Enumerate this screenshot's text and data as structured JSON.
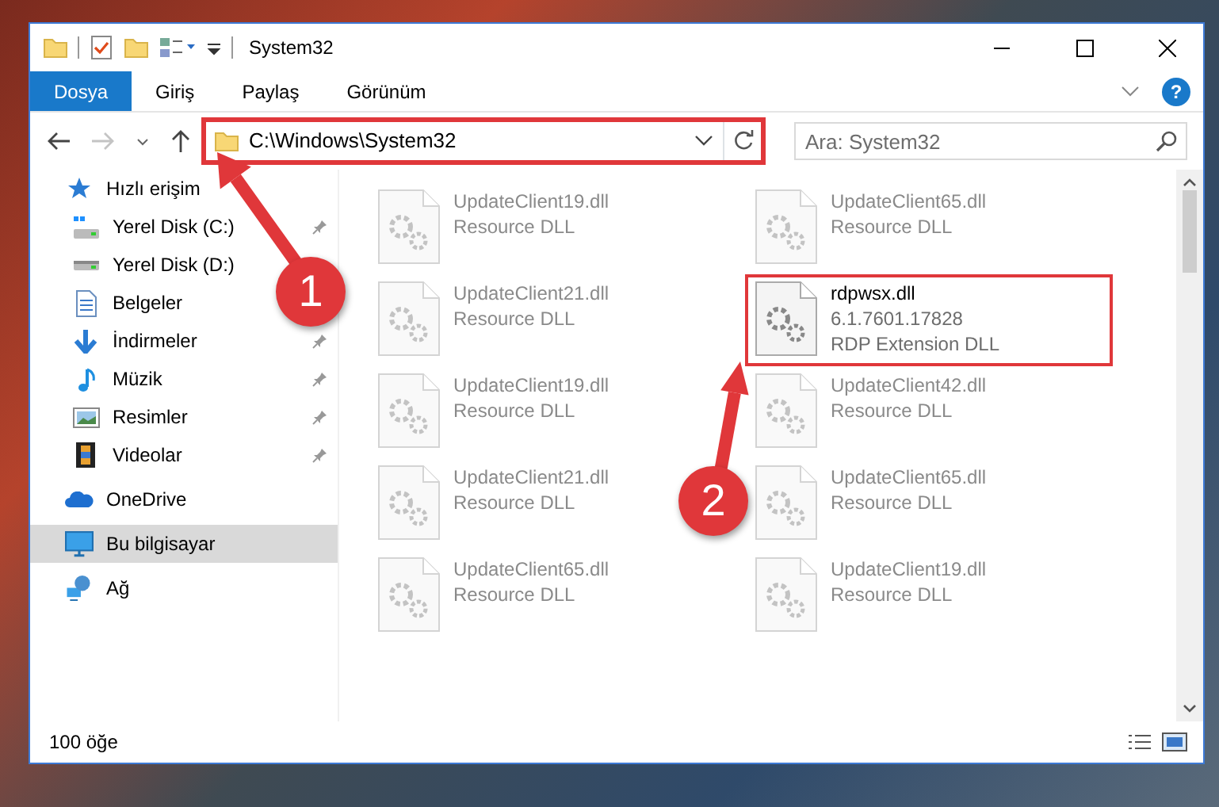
{
  "window": {
    "title": "System32"
  },
  "ribbon": {
    "tabs": [
      {
        "label": "Dosya",
        "kind": "file",
        "selected": false
      },
      {
        "label": "Giriş",
        "kind": "tab",
        "selected": false
      },
      {
        "label": "Paylaş",
        "kind": "tab",
        "selected": false
      },
      {
        "label": "Görünüm",
        "kind": "tab",
        "selected": false
      }
    ],
    "help": "?"
  },
  "navigation": {
    "back_disabled": false,
    "forward_disabled": true,
    "address": {
      "value": "C:\\Windows\\System32",
      "highlighted": true
    },
    "search": {
      "placeholder": "Ara: System32"
    }
  },
  "sidebar": {
    "items": [
      {
        "label": "Hızlı erişim",
        "pinned": false,
        "selected": false,
        "children": [
          {
            "label": "Yerel Disk (C:)",
            "pinned": true,
            "selected": false
          },
          {
            "label": "Yerel Disk (D:)",
            "pinned": false,
            "selected": false
          },
          {
            "label": "Belgeler",
            "pinned": false,
            "selected": false
          },
          {
            "label": "İndirmeler",
            "pinned": true,
            "selected": false
          },
          {
            "label": "Müzik",
            "pinned": true,
            "selected": false
          },
          {
            "label": "Resimler",
            "pinned": true,
            "selected": false
          },
          {
            "label": "Videolar",
            "pinned": true,
            "selected": false
          }
        ]
      },
      {
        "label": "OneDrive",
        "pinned": false,
        "selected": false
      },
      {
        "label": "Bu bilgisayar",
        "pinned": false,
        "selected": true
      },
      {
        "label": "Ağ",
        "pinned": false,
        "selected": false
      }
    ]
  },
  "files": [
    {
      "name": "UpdateClient19.dll",
      "details": [
        "Resource DLL"
      ],
      "dimmed": true,
      "highlighted": false
    },
    {
      "name": "UpdateClient65.dll",
      "details": [
        "Resource DLL"
      ],
      "dimmed": true,
      "highlighted": false
    },
    {
      "name": "UpdateClient21.dll",
      "details": [
        "Resource DLL"
      ],
      "dimmed": true,
      "highlighted": false
    },
    {
      "name": "rdpwsx.dll",
      "details": [
        "6.1.7601.17828",
        "RDP Extension DLL"
      ],
      "dimmed": false,
      "highlighted": true
    },
    {
      "name": "UpdateClient19.dll",
      "details": [
        "Resource DLL"
      ],
      "dimmed": true,
      "highlighted": false
    },
    {
      "name": "UpdateClient42.dll",
      "details": [
        "Resource DLL"
      ],
      "dimmed": true,
      "highlighted": false
    },
    {
      "name": "UpdateClient21.dll",
      "details": [
        "Resource DLL"
      ],
      "dimmed": true,
      "highlighted": false
    },
    {
      "name": "UpdateClient65.dll",
      "details": [
        "Resource DLL"
      ],
      "dimmed": true,
      "highlighted": false
    },
    {
      "name": "UpdateClient65.dll",
      "details": [
        "Resource DLL"
      ],
      "dimmed": true,
      "highlighted": false
    },
    {
      "name": "UpdateClient19.dll",
      "details": [
        "Resource DLL"
      ],
      "dimmed": true,
      "highlighted": false
    }
  ],
  "status_bar": {
    "item_count": "100 öğe"
  },
  "annotations": [
    {
      "number": "1"
    },
    {
      "number": "2"
    }
  ]
}
